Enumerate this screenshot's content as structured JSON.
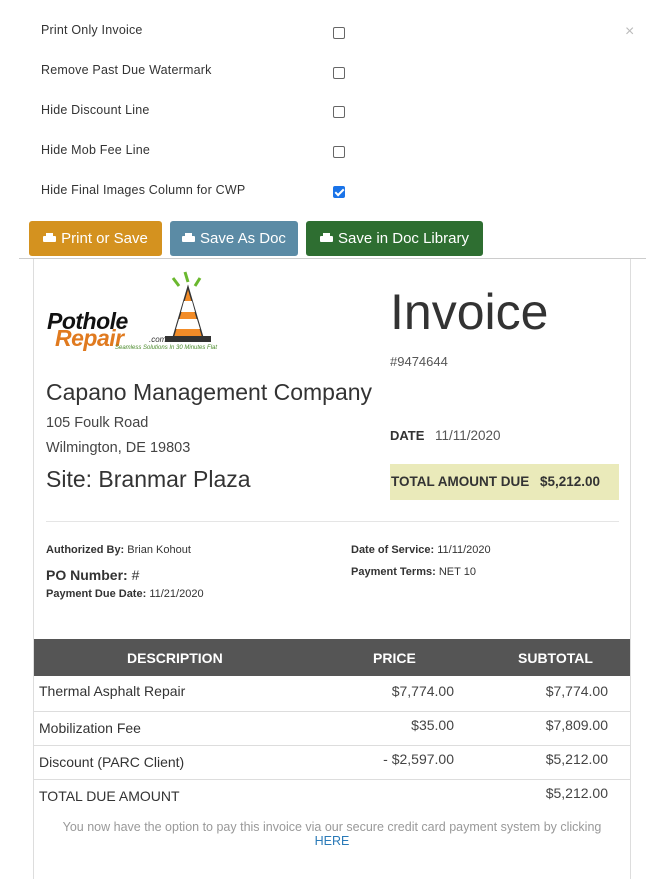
{
  "options": [
    {
      "label": "Print Only Invoice",
      "checked": false
    },
    {
      "label": "Remove Past Due Watermark",
      "checked": false
    },
    {
      "label": "Hide Discount Line",
      "checked": false
    },
    {
      "label": "Hide Mob Fee Line",
      "checked": false
    },
    {
      "label": "Hide Final Images Column for CWP",
      "checked": true
    }
  ],
  "close_label": "×",
  "buttons": {
    "print_save": "Print or Save",
    "save_doc": "Save As Doc",
    "save_library": "Save in Doc Library"
  },
  "colors": {
    "print_save": "#d4921f",
    "save_doc": "#5b8ba5",
    "save_library": "#2e6e31",
    "table_head": "#555555",
    "total_bg": "#eaeaba"
  },
  "logo": {
    "line1": "Pothole",
    "line2": "Repair",
    "suffix": ".com",
    "tagline": "Seamless Solutions In 30 Minutes Flat"
  },
  "invoice": {
    "title": "Invoice",
    "number": "#9474644",
    "date_label": "DATE",
    "date": "11/11/2020",
    "total_label": "TOTAL AMOUNT DUE",
    "total": "$5,212.00"
  },
  "client": {
    "company": "Capano Management Company",
    "address1": "105 Foulk Road",
    "address2": "Wilmington, DE 19803",
    "site": "Site: Branmar Plaza"
  },
  "meta": {
    "authorized_label": "Authorized By:",
    "authorized": "Brian Kohout",
    "po_label": "PO Number:",
    "po": "#",
    "due_label": "Payment Due Date:",
    "due": "11/21/2020",
    "service_label": "Date of Service:",
    "service": "11/11/2020",
    "terms_label": "Payment Terms:",
    "terms": "NET 10"
  },
  "table": {
    "headers": [
      "DESCRIPTION",
      "PRICE",
      "SUBTOTAL"
    ],
    "rows": [
      {
        "description": "Thermal Asphalt Repair",
        "price": "$7,774.00",
        "subtotal": "$7,774.00"
      },
      {
        "description": "Mobilization Fee",
        "price": "$35.00",
        "subtotal": "$7,809.00"
      },
      {
        "description": "Discount (PARC Client)",
        "price": "- $2,597.00",
        "subtotal": "$5,212.00"
      },
      {
        "description": "TOTAL DUE AMOUNT",
        "price": "",
        "subtotal": "$5,212.00"
      }
    ]
  },
  "footer": {
    "note": "You now have the option to pay this invoice via our secure credit card payment system by clicking",
    "link": "HERE"
  }
}
